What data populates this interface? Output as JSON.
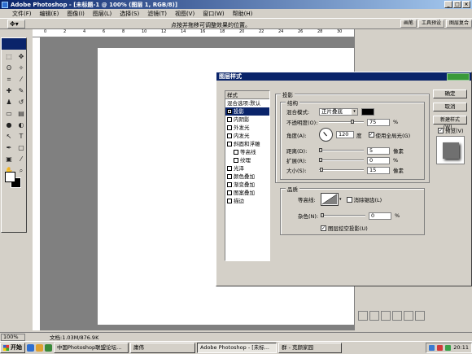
{
  "window": {
    "title": "Adobe Photoshop - [未标题-1 @ 100% (图层 1, RGB/8)]"
  },
  "menu": [
    "文件(F)",
    "编辑(E)",
    "图像(I)",
    "图层(L)",
    "选择(S)",
    "滤镜(T)",
    "视图(V)",
    "窗口(W)",
    "帮助(H)"
  ],
  "options": {
    "hint": "点按并拖移可调整效果的位置。"
  },
  "palette_well": [
    "画笔",
    "工具预设",
    "图层复合"
  ],
  "ruler_ticks": [
    "0",
    "2",
    "4",
    "6",
    "8",
    "10",
    "12",
    "14",
    "16",
    "18",
    "20",
    "22",
    "24",
    "26",
    "28",
    "30",
    "32",
    "34",
    "36",
    "38",
    "40",
    "42"
  ],
  "dialog": {
    "title": "图层样式",
    "style_list": [
      {
        "label": "样式",
        "type": "header"
      },
      {
        "label": "混合选项:默认",
        "type": "plain"
      },
      {
        "label": "投影",
        "type": "check",
        "checked": true,
        "selected": true
      },
      {
        "label": "内阴影",
        "type": "check"
      },
      {
        "label": "外发光",
        "type": "check"
      },
      {
        "label": "内发光",
        "type": "check"
      },
      {
        "label": "斜面和浮雕",
        "type": "check"
      },
      {
        "label": "等高线",
        "type": "check",
        "indent": true
      },
      {
        "label": "纹理",
        "type": "check",
        "indent": true
      },
      {
        "label": "光泽",
        "type": "check"
      },
      {
        "label": "颜色叠加",
        "type": "check"
      },
      {
        "label": "渐变叠加",
        "type": "check"
      },
      {
        "label": "图案叠加",
        "type": "check"
      },
      {
        "label": "描边",
        "type": "check"
      }
    ],
    "section": "投影",
    "structure": {
      "title": "结构",
      "blend_label": "混合模式:",
      "blend_value": "正片叠底",
      "shadow_color": "#000000",
      "opacity_label": "不透明度(O):",
      "opacity_value": "75",
      "opacity_unit": "%",
      "opacity_level": 0.75,
      "angle_label": "角度(A):",
      "angle_value": "120",
      "angle_unit": "度",
      "global_light_label": "使用全局光(G)",
      "distance_label": "距离(D):",
      "distance_value": "5",
      "distance_unit": "像素",
      "distance_level": 0.02,
      "spread_label": "扩展(R):",
      "spread_value": "0",
      "spread_unit": "%",
      "spread_level": 0,
      "size_label": "大小(S):",
      "size_value": "15",
      "size_unit": "像素",
      "size_level": 0.06
    },
    "quality": {
      "title": "品质",
      "contour_label": "等高线:",
      "antialias_label": "消除锯齿(L)",
      "noise_label": "杂色(N):",
      "noise_value": "0",
      "noise_unit": "%",
      "noise_level": 0,
      "knockout_label": "图层挖空投影(U)"
    },
    "buttons": {
      "ok": "确定",
      "cancel": "取消",
      "new_style": "新建样式(W)...",
      "preview": "预览(V)"
    }
  },
  "statusbar": {
    "zoom": "100%",
    "doc": "文档:1.03M/876.9K"
  },
  "taskbar": {
    "start": "开始",
    "items": [
      "中国Photoshop联盟论坛...",
      "庸伟",
      "Adobe Photoshop - [未标...",
      "群 - 克颜家园"
    ],
    "active_index": 2,
    "clock": "20:11"
  }
}
